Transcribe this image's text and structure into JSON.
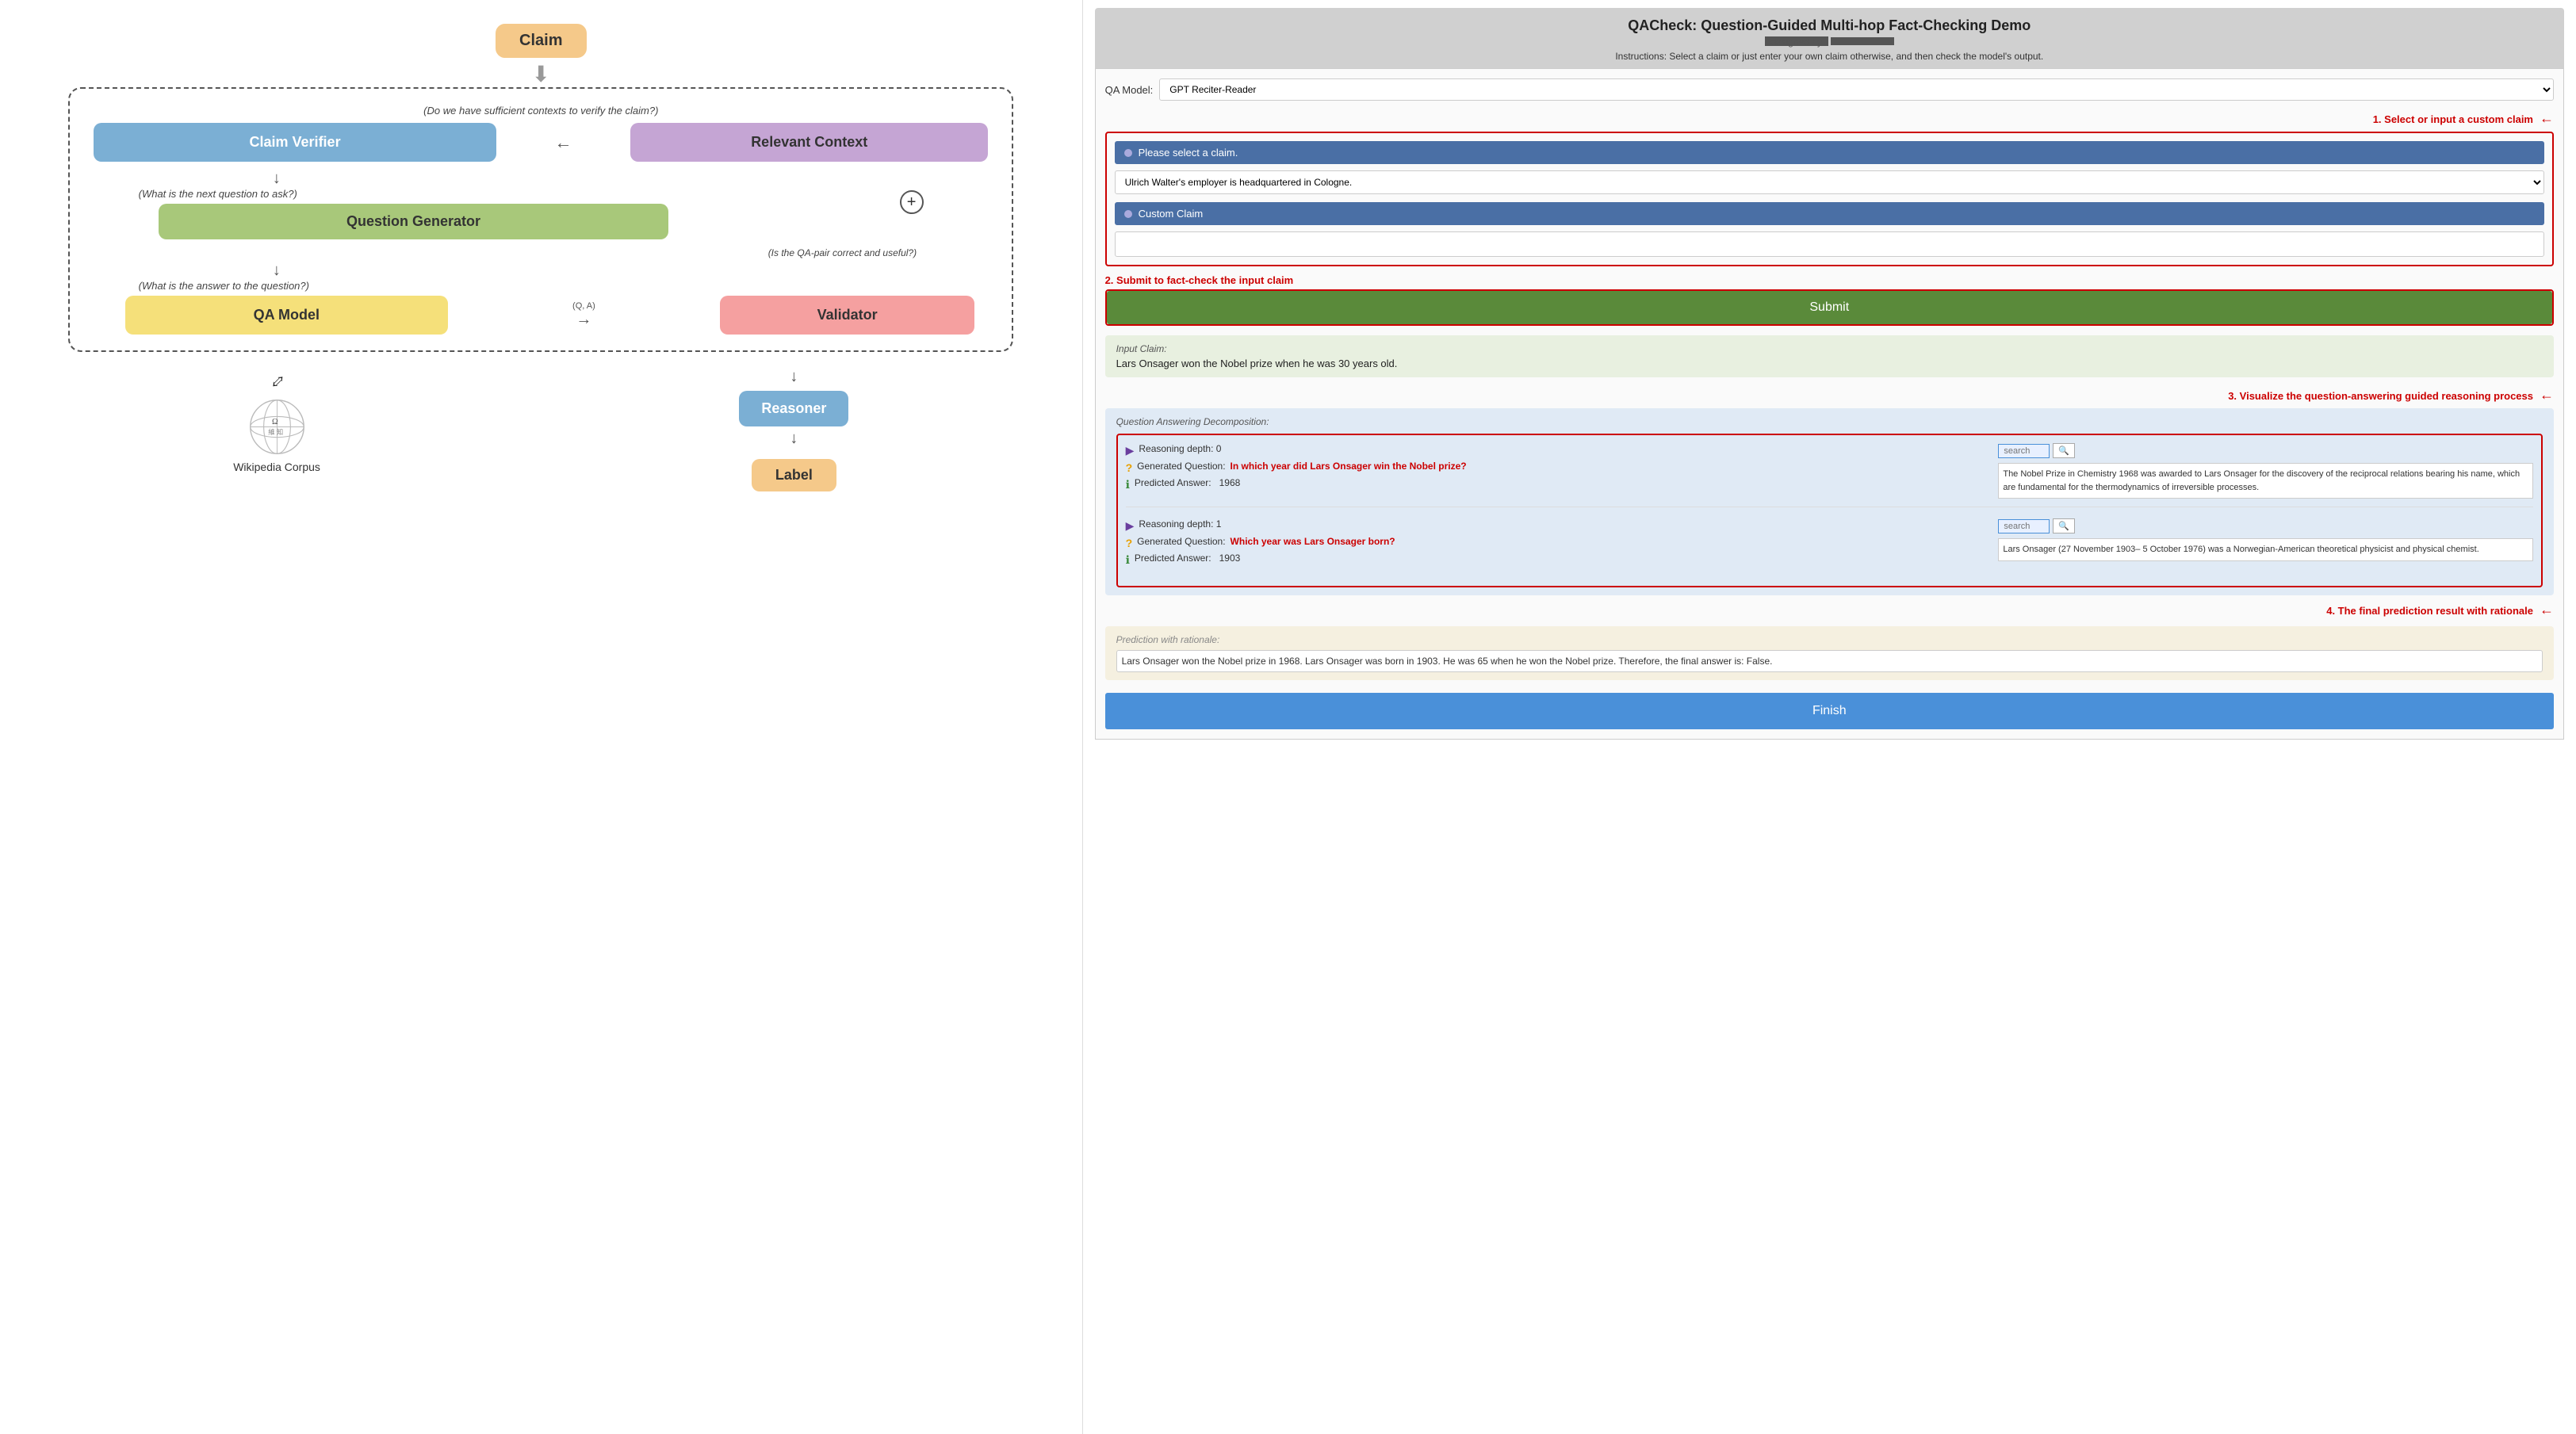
{
  "left": {
    "claim_label": "Claim",
    "dashed_question": "(Do we have sufficient contexts to verify the claim?)",
    "claim_verifier": "Claim Verifier",
    "relevant_context": "Relevant Context",
    "next_question": "(What is the next question to ask?)",
    "question_generator": "Question Generator",
    "is_qa_correct": "(Is the QA-pair correct and useful?)",
    "answer_question": "(What is the answer to the question?)",
    "qa_model": "QA Model",
    "qa_arrow_label": "(Q, A)",
    "validator": "Validator",
    "wiki_label": "Wikipedia Corpus",
    "reasoner": "Reasoner",
    "label": "Label",
    "plus": "+"
  },
  "right": {
    "title": "QACheck: Question-Guided Multi-hop Fact-Checking Demo",
    "designed_by": "designed by",
    "instructions": "Instructions: Select a claim or just enter your own claim otherwise, and then check the model's output.",
    "model_label": "QA Model:",
    "model_value": "GPT Reciter-Reader",
    "claim_select_header": "Please select a claim.",
    "claim_dropdown_value": "Ulrich Walter's employer is headquartered in Cologne.",
    "custom_claim_header": "Custom Claim",
    "custom_claim_placeholder": "",
    "submit_label": "Submit",
    "annotation1": "1. Select or input a custom claim",
    "annotation2": "2. Submit to fact-check the input claim",
    "annotation3": "3. Visualize the question-answering guided reasoning process",
    "annotation4": "4. The final prediction result with rationale",
    "input_claim_label": "Input Claim:",
    "input_claim_text": "Lars Onsager won the Nobel prize when he was 30 years old.",
    "qa_decomp_label": "Question Answering Decomposition:",
    "steps": [
      {
        "depth": "Reasoning depth: 0",
        "question_label": "Generated Question:",
        "question_text": "In which year did Lars Onsager win the Nobel prize?",
        "answer_label": "Predicted Answer:",
        "answer_text": "1968",
        "search_placeholder": "search",
        "context": "The Nobel Prize in Chemistry 1968 was awarded to Lars Onsager for the discovery of the reciprocal relations bearing his name, which are fundamental for the thermodynamics of irreversible processes."
      },
      {
        "depth": "Reasoning depth: 1",
        "question_label": "Generated Question:",
        "question_text": "Which year was Lars Onsager born?",
        "answer_label": "Predicted Answer:",
        "answer_text": "1903",
        "search_placeholder": "search",
        "context": "Lars Onsager (27 November 1903– 5 October 1976) was a Norwegian-American theoretical physicist and physical chemist."
      }
    ],
    "prediction_label": "Prediction with rationale:",
    "prediction_text": "Lars Onsager won the Nobel prize in 1968. Lars Onsager was born in 1903. He was 65 when he won the Nobel prize. Therefore, the final answer is: False.",
    "finish_label": "Finish"
  }
}
